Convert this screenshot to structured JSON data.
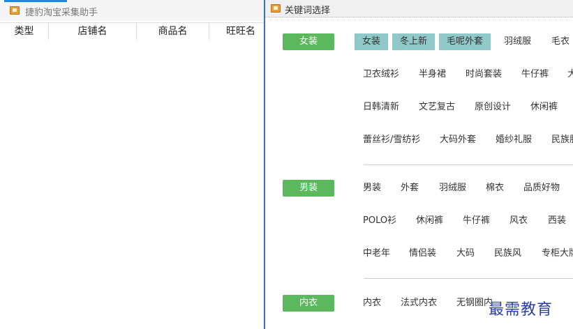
{
  "main_window": {
    "title": "捷豹淘宝采集助手",
    "table": {
      "columns": [
        "类型",
        "店铺名",
        "商品名",
        "旺旺名"
      ]
    }
  },
  "dialog": {
    "title": "关键词选择",
    "categories": [
      {
        "label": "女装",
        "rows": [
          [
            "女装",
            "冬上新",
            "毛呢外套",
            "羽绒服",
            "毛衣"
          ],
          [
            "卫衣绒衫",
            "半身裙",
            "时尚套装",
            "牛仔裤",
            "大"
          ],
          [
            "日韩清新",
            "文艺复古",
            "原创设计",
            "休闲裤"
          ],
          [
            "蕾丝衫/雪纺衫",
            "大码外套",
            "婚纱礼服",
            "民族服"
          ]
        ],
        "selected": [
          "女装",
          "冬上新",
          "毛呢外套"
        ]
      },
      {
        "label": "男装",
        "rows": [
          [
            "男装",
            "外套",
            "羽绒服",
            "棉衣",
            "品质好物"
          ],
          [
            "POLO衫",
            "休闲裤",
            "牛仔裤",
            "风衣",
            "西装"
          ],
          [
            "中老年",
            "情侣装",
            "大码",
            "民族风",
            "专柜大牌"
          ]
        ],
        "selected": []
      },
      {
        "label": "内衣",
        "rows": [
          [
            "内衣",
            "法式内衣",
            "无钢圈内"
          ]
        ],
        "selected": []
      }
    ]
  },
  "watermark": "最需教育",
  "colors": {
    "category_button": "#5cb85c",
    "selected_keyword": "#8fc9c9",
    "dialog_border": "#3a6fc4",
    "watermark": "#2a3fa8"
  }
}
